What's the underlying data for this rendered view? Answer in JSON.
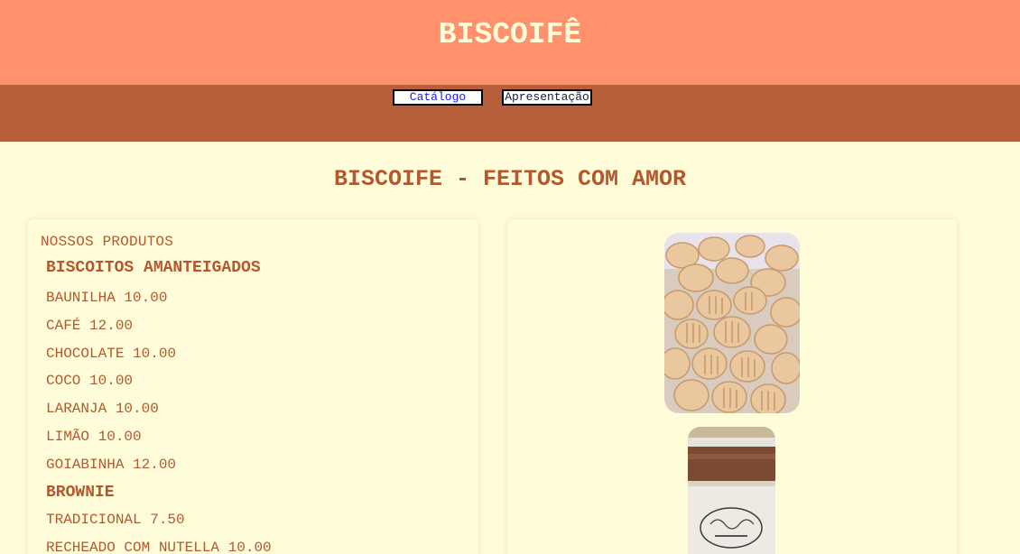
{
  "header": {
    "title": "BISCOIFÊ"
  },
  "nav": {
    "catalog_label": "Catálogo",
    "intro_label": "Apresentação"
  },
  "main": {
    "heading": "BISCOIFE - FEITOS COM AMOR"
  },
  "products": {
    "label": "NOSSOS PRODUTOS",
    "categories": [
      {
        "name": "BISCOITOS AMANTEIGADOS",
        "items": [
          "BAUNILHA 10.00",
          "CAFÉ 12.00",
          "CHOCOLATE 10.00",
          "COCO 10.00",
          "LARANJA 10.00",
          "LIMÃO 10.00",
          "GOIABINHA 12.00"
        ]
      },
      {
        "name": "BROWNIE",
        "items": [
          "TRADICIONAL 7.50",
          "RECHEADO COM NUTELLA 10.00"
        ]
      }
    ]
  },
  "colors": {
    "header_bg": "#ff916d",
    "nav_bg": "#b95e3b",
    "page_bg": "#fffdd9",
    "accent_text": "#b4582f"
  }
}
